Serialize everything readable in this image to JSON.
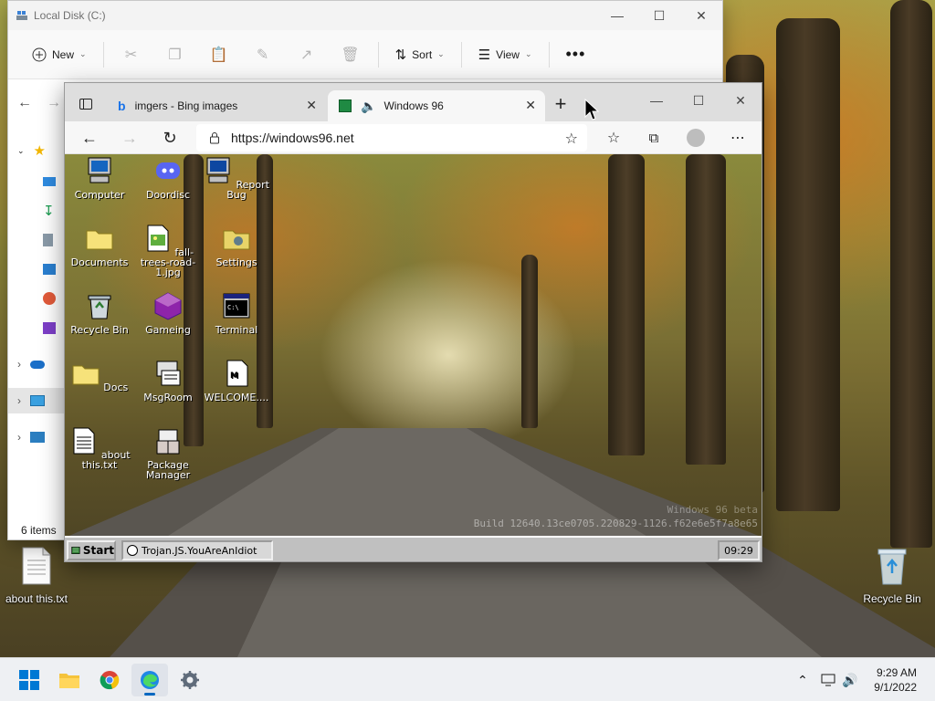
{
  "explorer": {
    "title": "Local Disk (C:)",
    "commands": {
      "new_label": "New",
      "sort_label": "Sort",
      "view_label": "View"
    },
    "status": "6 items"
  },
  "browser": {
    "tabs": [
      {
        "label": "imgers - Bing images"
      },
      {
        "label": "Windows 96"
      }
    ],
    "url": "https://windows96.net"
  },
  "w96": {
    "icons": [
      {
        "label": "Computer",
        "icon": "computer-icon"
      },
      {
        "label": "Doordisc",
        "icon": "discord-icon"
      },
      {
        "label": "Report Bug",
        "icon": "report-bug-icon"
      },
      {
        "label": "Documents",
        "icon": "folder-icon"
      },
      {
        "label": "fall-trees-road-1.jpg",
        "icon": "image-file-icon"
      },
      {
        "label": "Settings",
        "icon": "settings-folder-icon"
      },
      {
        "label": "Recycle Bin",
        "icon": "recycle-bin-icon"
      },
      {
        "label": "Gameing",
        "icon": "game-icon"
      },
      {
        "label": "Terminal",
        "icon": "terminal-icon"
      },
      {
        "label": "Docs",
        "icon": "folder-icon"
      },
      {
        "label": "MsgRoom",
        "icon": "msgroom-icon"
      },
      {
        "label": "WELCOME....",
        "icon": "markdown-file-icon"
      },
      {
        "label": "about this.txt",
        "icon": "text-file-icon"
      },
      {
        "label": "Package Manager",
        "icon": "package-icon"
      }
    ],
    "build": "Build 12640.13ce0705.220829-1126.f62e6e5f7a8e65",
    "watermark": "Windows 96 beta",
    "taskbar": {
      "start_label": "Start",
      "task_label": "Trojan.JS.YouAreAnIdiot",
      "clock": "09:29"
    }
  },
  "desktop": {
    "icons": [
      {
        "label": "about this.txt",
        "icon": "text-file-icon"
      },
      {
        "label": "Recycle Bin",
        "icon": "recycle-bin-icon"
      }
    ]
  },
  "taskbar": {
    "time": "9:29 AM",
    "date": "9/1/2022"
  }
}
